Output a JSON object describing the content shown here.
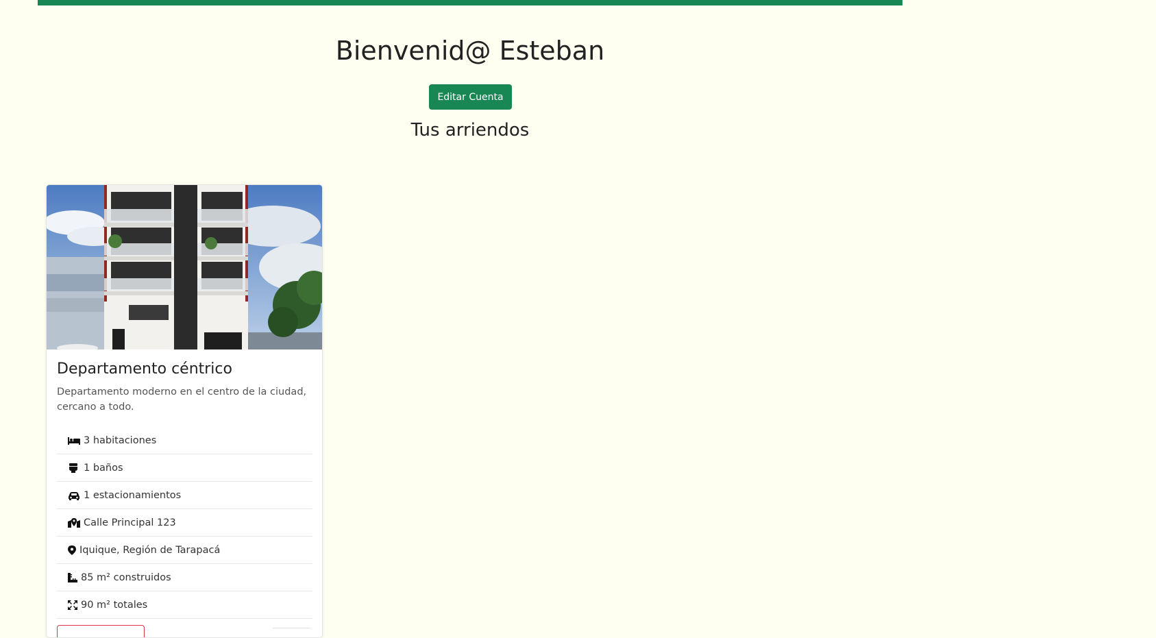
{
  "header": {
    "welcome": "Bienvenid@ Esteban",
    "edit_account_label": "Editar Cuenta",
    "rentals_title": "Tus arriendos"
  },
  "colors": {
    "accent": "#198754",
    "background": "#fefff0",
    "danger": "#dc3545"
  },
  "listing": {
    "title": "Departamento céntrico",
    "description": "Departamento moderno en el centro de la ciudad, cercano a todo.",
    "features": [
      {
        "icon": "bed-icon",
        "text": "3 habitaciones"
      },
      {
        "icon": "toilet-icon",
        "text": "1 baños"
      },
      {
        "icon": "car-icon",
        "text": "1 estacionamientos"
      },
      {
        "icon": "map-location-icon",
        "text": "Calle Principal 123"
      },
      {
        "icon": "map-pin-icon",
        "text": "Iquique, Región de Tarapacá"
      },
      {
        "icon": "ruler-icon",
        "text": "85 m² construidos"
      },
      {
        "icon": "expand-icon",
        "text": "90 m² totales"
      }
    ]
  }
}
